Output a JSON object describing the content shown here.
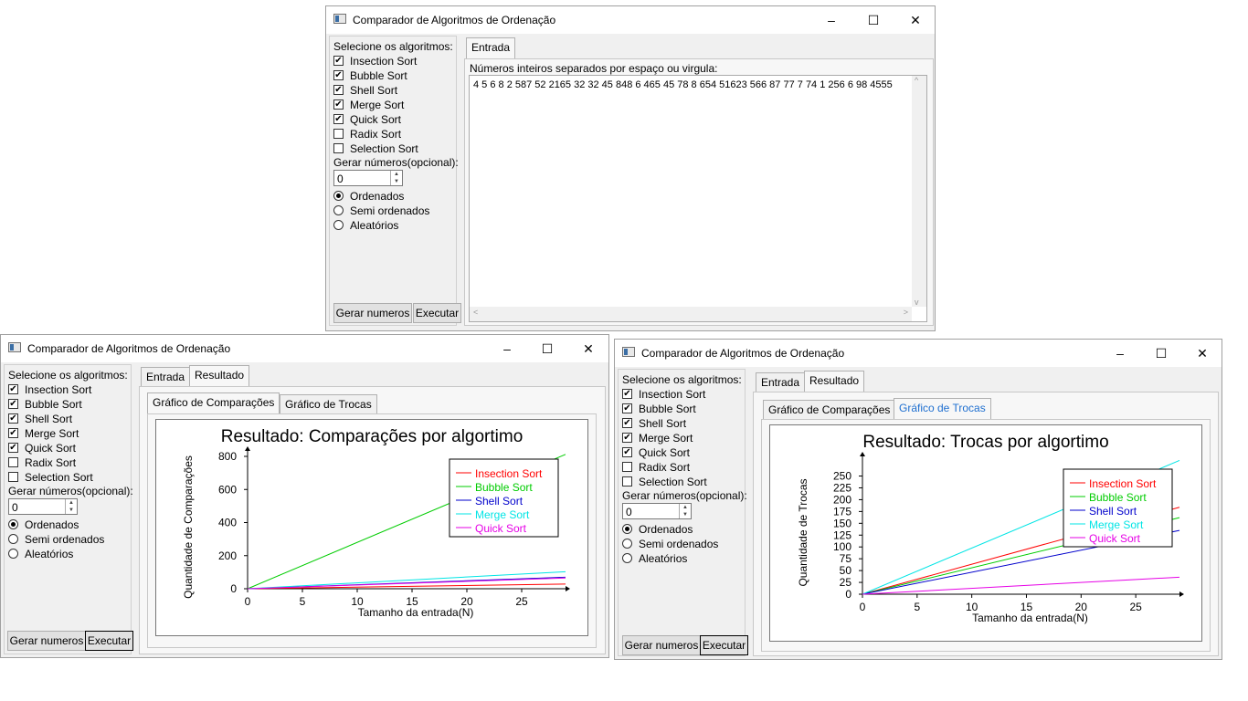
{
  "app_title": "Comparador de Algoritmos de Ordenação",
  "left_panel": {
    "header": "Selecione os algoritmos:",
    "generate_label": "Gerar números(opcional):",
    "order_options": [
      "Ordenados",
      "Semi ordenados",
      "Aleatórios"
    ],
    "buttons": {
      "generate": "Gerar numeros",
      "run": "Executar"
    }
  },
  "tabs": {
    "input": "Entrada",
    "result": "Resultado"
  },
  "sub_tabs": {
    "comparisons": "Gráfico de Comparações",
    "swaps": "Gráfico de Trocas"
  },
  "window_top": {
    "algorithms": [
      {
        "label": "Insection Sort",
        "checked": true
      },
      {
        "label": "Bubble Sort",
        "checked": true
      },
      {
        "label": "Shell Sort",
        "checked": true
      },
      {
        "label": "Merge Sort",
        "checked": true
      },
      {
        "label": "Quick Sort",
        "checked": true
      },
      {
        "label": "Radix Sort",
        "checked": false
      },
      {
        "label": "Selection Sort",
        "checked": false
      }
    ],
    "spin_value": "0",
    "selected_order": 0,
    "input_label": "Números inteiros separados por espaço ou virgula:",
    "input_value": "4 5 6 8 2 587 52 2165 32 32 45 848 6 465 45 78 8 654 51623 566 87 77 7 74 1 256 6 98 4555"
  },
  "window_left": {
    "algorithms": [
      {
        "label": "Insection Sort",
        "checked": true
      },
      {
        "label": "Bubble Sort",
        "checked": true
      },
      {
        "label": "Shell Sort",
        "checked": true
      },
      {
        "label": "Merge Sort",
        "checked": true
      },
      {
        "label": "Quick Sort",
        "checked": true
      },
      {
        "label": "Radix Sort",
        "checked": false
      },
      {
        "label": "Selection Sort",
        "checked": false
      }
    ],
    "spin_value": "0",
    "selected_order": 0
  },
  "window_right": {
    "algorithms": [
      {
        "label": "Insection Sort",
        "checked": true
      },
      {
        "label": "Bubble Sort",
        "checked": true
      },
      {
        "label": "Shell Sort",
        "checked": true
      },
      {
        "label": "Merge Sort",
        "checked": true
      },
      {
        "label": "Quick Sort",
        "checked": true
      },
      {
        "label": "Radix Sort",
        "checked": false
      },
      {
        "label": "Selection Sort",
        "checked": false
      }
    ],
    "spin_value": "0",
    "selected_order": 0
  },
  "chart_data": [
    {
      "type": "line",
      "title": "Resultado: Comparações por algortimo",
      "xlabel": "Tamanho da entrada(N)",
      "ylabel": "Quantidade de Comparações",
      "xlim": [
        0,
        29
      ],
      "ylim": [
        0,
        800
      ],
      "xticks": [
        0,
        5,
        10,
        15,
        20,
        25
      ],
      "yticks": [
        0,
        200,
        400,
        600,
        800
      ],
      "legend": "top-right",
      "series": [
        {
          "name": "Insection Sort",
          "color": "#ff0000",
          "x": [
            0,
            29
          ],
          "y": [
            0,
            28
          ]
        },
        {
          "name": "Bubble Sort",
          "color": "#00cc00",
          "x": [
            0,
            29
          ],
          "y": [
            0,
            812
          ]
        },
        {
          "name": "Shell Sort",
          "color": "#0000cc",
          "x": [
            0,
            29
          ],
          "y": [
            0,
            70
          ]
        },
        {
          "name": "Merge Sort",
          "color": "#00e5e5",
          "x": [
            0,
            29
          ],
          "y": [
            0,
            103
          ]
        },
        {
          "name": "Quick Sort",
          "color": "#e600e6",
          "x": [
            0,
            29
          ],
          "y": [
            0,
            65
          ]
        }
      ]
    },
    {
      "type": "line",
      "title": "Resultado: Trocas por algortimo",
      "xlabel": "Tamanho da entrada(N)",
      "ylabel": "Quantidade de Trocas",
      "xlim": [
        0,
        29
      ],
      "ylim": [
        0,
        280
      ],
      "xticks": [
        0,
        5,
        10,
        15,
        20,
        25
      ],
      "yticks": [
        0,
        25,
        50,
        75,
        100,
        125,
        150,
        175,
        200,
        225,
        250
      ],
      "legend": "top-right",
      "series": [
        {
          "name": "Insection Sort",
          "color": "#ff0000",
          "x": [
            0,
            29
          ],
          "y": [
            0,
            184
          ]
        },
        {
          "name": "Bubble Sort",
          "color": "#00cc00",
          "x": [
            0,
            29
          ],
          "y": [
            0,
            162
          ]
        },
        {
          "name": "Shell Sort",
          "color": "#0000cc",
          "x": [
            0,
            29
          ],
          "y": [
            0,
            135
          ]
        },
        {
          "name": "Merge Sort",
          "color": "#00e5e5",
          "x": [
            0,
            29
          ],
          "y": [
            0,
            283
          ]
        },
        {
          "name": "Quick Sort",
          "color": "#e600e6",
          "x": [
            0,
            29
          ],
          "y": [
            0,
            36
          ]
        }
      ]
    }
  ]
}
